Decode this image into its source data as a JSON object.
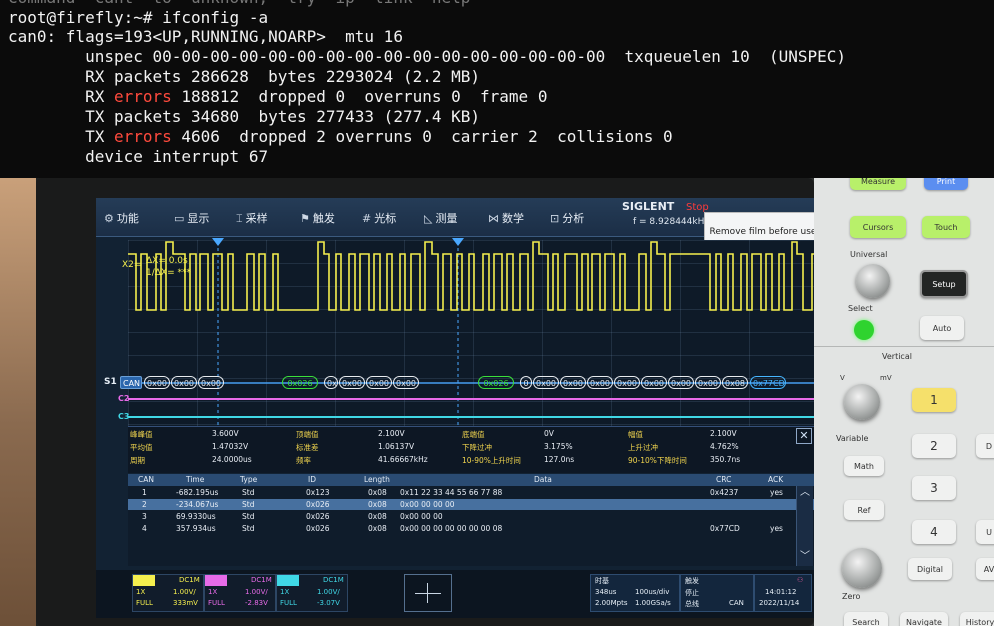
{
  "terminal": {
    "partial_top": "Command  cant  to  unknown,  try  ip  link  help",
    "prompt": "root@firefly:~# ifconfig -a",
    "l1": "can0: flags=193<UP,RUNNING,NOARP>  mtu 16",
    "l2": "        unspec 00-00-00-00-00-00-00-00-00-00-00-00-00-00-00-00  txqueuelen 10  (UNSPEC)",
    "l3": "        RX packets 286628  bytes 2293024 (2.2 MB)",
    "l4a": "        RX ",
    "l4err": "errors",
    "l4b": " 188812  dropped 0  overruns 0  frame 0",
    "l5": "        TX packets 34680  bytes 277433 (277.4 KB)",
    "l6a": "        TX ",
    "l6err": "errors",
    "l6b": " 4606  dropped 2 overruns 0  carrier 2  collisions 0",
    "l7": "        device interrupt 67"
  },
  "scope": {
    "menu": [
      "功能",
      "显示",
      "采样",
      "触发",
      "光标",
      "测量",
      "数学",
      "分析"
    ],
    "brand": "SIGLENT",
    "stop": "Stop",
    "freq": "f = 8.928444kHz",
    "film_notice": "Remove film before use",
    "cursor_x2": "X2=",
    "delta_x": "ΔX= 0.0s",
    "inv_delta_x": "1/ΔX= ***",
    "bus_label": "S1",
    "bus_tag": "CAN",
    "frames1": [
      "0x00",
      "0x00",
      "0x00"
    ],
    "id1": "0x026",
    "frames2_lead": "0x",
    "frames2": [
      "0x00",
      "0x00",
      "0x00"
    ],
    "id2": "0x026",
    "frames3_lead": "0",
    "frames3": [
      "0x00",
      "0x00",
      "0x00",
      "0x00",
      "0x00",
      "0x00",
      "0x00",
      "0x08"
    ],
    "crc_tag": "0x77CD",
    "c2": "C2",
    "c3": "C3",
    "measurements": [
      {
        "k": "峰峰值",
        "v": "3.600V"
      },
      {
        "k": "顶端值",
        "v": "2.100V"
      },
      {
        "k": "底端值",
        "v": "0V"
      },
      {
        "k": "幅值",
        "v": "2.100V"
      },
      {
        "k": "平均值",
        "v": "1.47032V"
      },
      {
        "k": "标准差",
        "v": "1.06137V"
      },
      {
        "k": "下降过冲",
        "v": "3.175%"
      },
      {
        "k": "上升过冲",
        "v": "4.762%"
      },
      {
        "k": "周期",
        "v": "24.0000us"
      },
      {
        "k": "频率",
        "v": "41.66667kHz"
      },
      {
        "k": "10-90%上升时间",
        "v": "127.0ns"
      },
      {
        "k": "90-10%下降时间",
        "v": "350.7ns"
      }
    ],
    "table": {
      "headers": [
        "CAN",
        "Time",
        "Type",
        "ID",
        "Length",
        "Data",
        "CRC",
        "ACK"
      ],
      "rows": [
        [
          "1",
          "-682.195us",
          "Std",
          "0x123",
          "0x08",
          "0x11 22 33 44 55 66 77 88",
          "0x4237",
          "yes"
        ],
        [
          "2",
          "-234.067us",
          "Std",
          "0x026",
          "0x08",
          "0x00 00 00 00",
          "",
          ""
        ],
        [
          "3",
          "69.9330us",
          "Std",
          "0x026",
          "0x08",
          "0x00 00 00",
          "",
          ""
        ],
        [
          "4",
          "357.934us",
          "Std",
          "0x026",
          "0x08",
          "0x00 00 00 00 00 00 00 08",
          "0x77CD",
          "yes"
        ]
      ]
    },
    "channels": [
      {
        "name": "C1",
        "coupling": "DC1M",
        "probe": "1X",
        "scale": "1.00V/",
        "mode": "FULL",
        "offset": "333mV",
        "color": "#f5ef4e"
      },
      {
        "name": "C2",
        "coupling": "DC1M",
        "probe": "1X",
        "scale": "1.00V/",
        "mode": "FULL",
        "offset": "-2.83V",
        "color": "#e86be8"
      },
      {
        "name": "C3",
        "coupling": "DC1M",
        "probe": "1X",
        "scale": "1.00V/",
        "mode": "FULL",
        "offset": "-3.07V",
        "color": "#40d8e6"
      }
    ],
    "timebase": {
      "label": "时基",
      "pos": "348us",
      "scale": "100us/div",
      "rate": "2.00Mpts",
      "sa": "1.00GSa/s"
    },
    "trigger": {
      "label": "触发",
      "state": "停止",
      "source": "总线",
      "type": "CAN"
    },
    "clock": {
      "time": "14:01:12",
      "date": "2022/11/14"
    }
  },
  "panel": {
    "measure": "Measure",
    "print": "Print",
    "cursors": "Cursors",
    "touch": "Touch",
    "universal": "Universal",
    "select": "Select",
    "setup": "Setup",
    "auto": "Auto",
    "vertical": "Vertical",
    "mv": "mV",
    "v": "V",
    "variable": "Variable",
    "b1": "1",
    "b2": "2",
    "b3": "3",
    "b4": "4",
    "math": "Math",
    "ref": "Ref",
    "digital": "Digital",
    "zero": "Zero",
    "search": "Search",
    "navigate": "Navigate",
    "history": "History",
    "right_d": "D",
    "right_u": "U",
    "right_a": "AV"
  }
}
